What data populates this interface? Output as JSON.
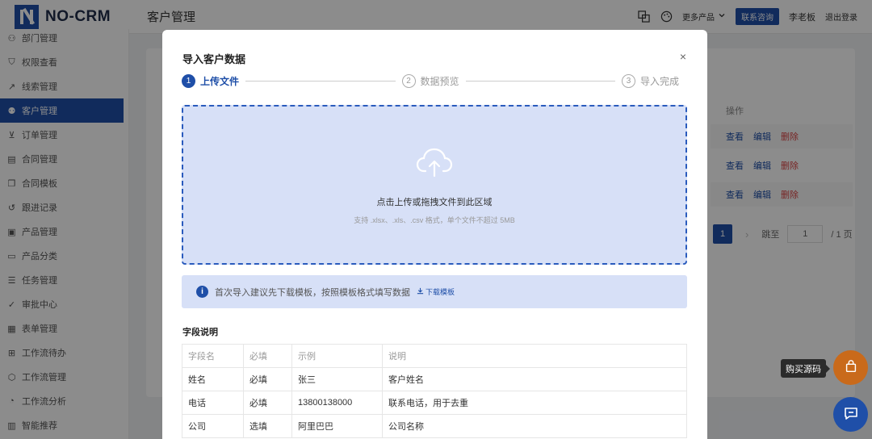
{
  "app": {
    "logo_text": "NO-CRM",
    "page_title": "客户管理"
  },
  "header": {
    "more_products": "更多产品",
    "contact_button": "联系咨询",
    "user_name": "李老板",
    "logout": "退出登录"
  },
  "sidebar": {
    "items": [
      {
        "label": "部门管理",
        "icon": "users-icon"
      },
      {
        "label": "权限查看",
        "icon": "shield-icon"
      },
      {
        "label": "线索管理",
        "icon": "trend-icon"
      },
      {
        "label": "客户管理",
        "icon": "user-add-icon",
        "active": true
      },
      {
        "label": "订单管理",
        "icon": "cart-icon"
      },
      {
        "label": "合同管理",
        "icon": "contract-icon"
      },
      {
        "label": "合同模板",
        "icon": "copy-icon"
      },
      {
        "label": "跟进记录",
        "icon": "history-icon"
      },
      {
        "label": "产品管理",
        "icon": "box-icon"
      },
      {
        "label": "产品分类",
        "icon": "folder-icon"
      },
      {
        "label": "任务管理",
        "icon": "list-icon"
      },
      {
        "label": "审批中心",
        "icon": "check-circle-icon"
      },
      {
        "label": "表单管理",
        "icon": "form-icon"
      },
      {
        "label": "工作流待办",
        "icon": "todo-icon"
      },
      {
        "label": "工作流管理",
        "icon": "cube-icon"
      },
      {
        "label": "工作流分析",
        "icon": "pie-icon"
      },
      {
        "label": "智能推荐",
        "icon": "chart-icon"
      }
    ]
  },
  "background": {
    "ops_header": "操作",
    "row_actions": {
      "view": "查看",
      "edit": "编辑",
      "delete": "删除"
    },
    "pager": {
      "current": "1",
      "jump_label": "跳至",
      "jump_value": "1",
      "total": "/ 1 页"
    }
  },
  "modal": {
    "title": "导入客户数据",
    "close": "×",
    "steps": [
      {
        "num": "1",
        "label": "上传文件",
        "state": "active"
      },
      {
        "num": "2",
        "label": "数据预览",
        "state": "pending"
      },
      {
        "num": "3",
        "label": "导入完成",
        "state": "pending"
      }
    ],
    "dropzone": {
      "title": "点击上传或拖拽文件到此区域",
      "hint": "支持 .xlsx、.xls、.csv 格式，单个文件不超过 5MB"
    },
    "info": {
      "text": "首次导入建议先下载模板，按照模板格式填写数据",
      "link": "下载模板"
    },
    "fields_title": "字段说明",
    "table": {
      "headers": [
        "字段名",
        "必填",
        "示例",
        "说明"
      ],
      "rows": [
        [
          "姓名",
          "必填",
          "张三",
          "客户姓名"
        ],
        [
          "电话",
          "必填",
          "13800138000",
          "联系电话，用于去重"
        ],
        [
          "公司",
          "选填",
          "阿里巴巴",
          "公司名称"
        ]
      ]
    }
  },
  "floating": {
    "buy_tooltip": "购买源码"
  },
  "colors": {
    "primary": "#1f4fa8",
    "danger": "#d94343",
    "buy_fab": "#c96a1b"
  }
}
